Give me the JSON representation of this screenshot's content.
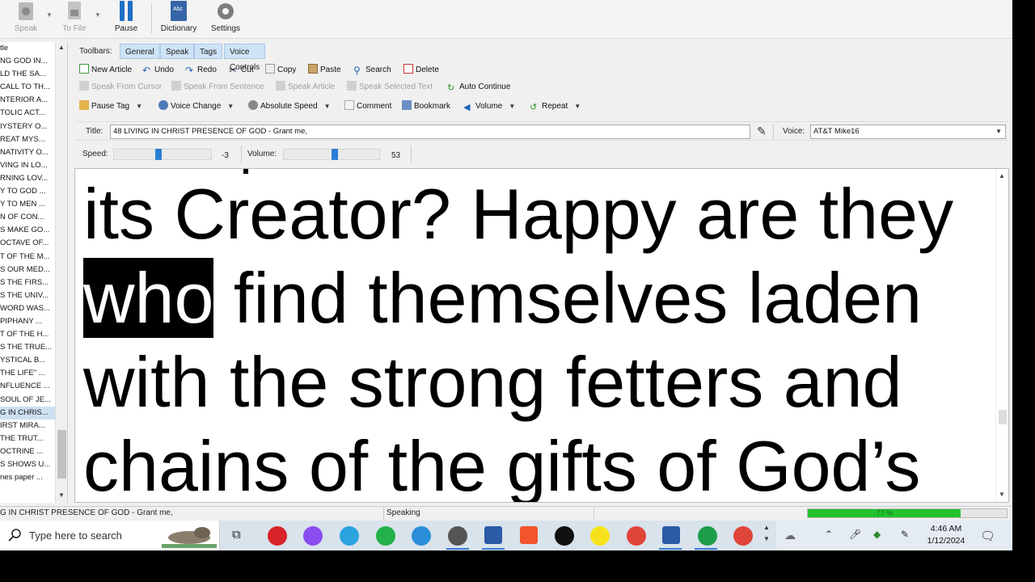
{
  "toolbar": {
    "buttons": [
      {
        "label": "Speak",
        "icon": "speaker-icon",
        "disabled": true
      },
      {
        "label": "To File",
        "icon": "file-audio-icon",
        "disabled": true
      },
      {
        "label": "Pause",
        "icon": "pause-icon",
        "disabled": false
      },
      {
        "label": "Dictionary",
        "icon": "dictionary-book-icon",
        "disabled": false
      },
      {
        "label": "Settings",
        "icon": "gear-icon",
        "disabled": false
      }
    ]
  },
  "article_list": {
    "items": [
      "tle",
      "NG GOD IN...",
      "LD THE SA...",
      "CALL TO TH...",
      "NTERIOR A...",
      "TOLIC ACT...",
      "IYSTERY O...",
      "REAT MYS...",
      "NATIVITY O...",
      "VING IN LO...",
      "RNING LOV...",
      "Y TO GOD ...",
      "Y TO MEN ...",
      "N OF CON...",
      "S MAKE GO...",
      "OCTAVE OF...",
      "T OF THE M...",
      "S OUR MED...",
      "S THE FIRS...",
      "S THE UNIV...",
      "WORD WAS...",
      "PIPHANY ...",
      "T OF THE H...",
      "S THE TRUE...",
      "YSTICAL B...",
      "THE LIFE\" ...",
      "NFLUENCE ...",
      "SOUL OF JE...",
      "G IN CHRIS...",
      "IRST MIRA...",
      "THE TRUT...",
      "OCTRINE ...",
      "S SHOWS U...",
      "nes paper ..."
    ],
    "selected_index": 28
  },
  "toolbars_row": {
    "label": "Toolbars:",
    "tabs": [
      "General",
      "Speak",
      "Tags",
      "Voice Controls"
    ]
  },
  "row1": [
    {
      "label": "New Article",
      "icon": "new-article-icon"
    },
    {
      "label": "Undo",
      "icon": "undo-icon"
    },
    {
      "label": "Redo",
      "icon": "redo-icon"
    },
    {
      "label": "Cut",
      "icon": "scissors-icon"
    },
    {
      "label": "Copy",
      "icon": "copy-icon"
    },
    {
      "label": "Paste",
      "icon": "paste-icon"
    },
    {
      "label": "Search",
      "icon": "search-icon"
    },
    {
      "label": "Delete",
      "icon": "delete-icon"
    }
  ],
  "row2": [
    {
      "label": "Speak From Cursor",
      "icon": "speak-cursor-icon",
      "disabled": true
    },
    {
      "label": "Speak From Sentence",
      "icon": "speak-sentence-icon",
      "disabled": true
    },
    {
      "label": "Speak Article",
      "icon": "speak-article-icon",
      "disabled": true
    },
    {
      "label": "Speak Selected Text",
      "icon": "speak-selected-icon",
      "disabled": true
    },
    {
      "label": "Auto Continue",
      "icon": "auto-continue-icon",
      "disabled": false
    }
  ],
  "row3": [
    {
      "label": "Pause Tag",
      "icon": "pause-tag-icon",
      "dropdown": true
    },
    {
      "label": "Voice Change",
      "icon": "voice-change-icon",
      "dropdown": true
    },
    {
      "label": "Absolute Speed",
      "icon": "speedometer-icon",
      "dropdown": true
    },
    {
      "label": "Comment",
      "icon": "comment-icon",
      "dropdown": false
    },
    {
      "label": "Bookmark",
      "icon": "bookmark-icon",
      "dropdown": false
    },
    {
      "label": "Volume",
      "icon": "volume-icon",
      "dropdown": true
    },
    {
      "label": "Repeat",
      "icon": "repeat-icon",
      "dropdown": true
    }
  ],
  "title_field": {
    "label": "Title:",
    "value": "48 LIVING IN CHRIST PRESENCE OF GOD - Grant me,"
  },
  "voice_field": {
    "label": "Voice:",
    "value": "AT&T Mike16"
  },
  "speed": {
    "label": "Speed:",
    "value": "-3",
    "level": 0.45
  },
  "volume": {
    "label": "Volume:",
    "value": "53",
    "level": 0.53
  },
  "reading": {
    "before": "its Creator? Happy are they ",
    "highlight": "who",
    "after": " find themselves laden with the strong fetters and chains of the gifts of God’s"
  },
  "status": {
    "article": "G IN CHRIST PRESENCE OF GOD - Grant me,",
    "state": "Speaking",
    "progress_label": "77 %",
    "progress": 0.77
  },
  "taskbar": {
    "search_placeholder": "Type here to search",
    "time": "4:46 AM",
    "date": "1/12/2024"
  },
  "colors": {
    "accent": "#2a7fd4",
    "tab_bg": "#cfe3f7",
    "progress": "#22c32e",
    "taskbar": "#d9e3ec"
  }
}
